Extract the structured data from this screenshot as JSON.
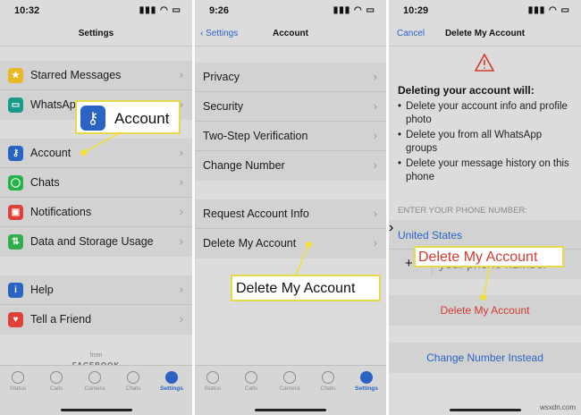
{
  "settings": {
    "time": "10:32",
    "title": "Settings",
    "rows": [
      {
        "label": "Starred Messages",
        "icon": "star-icon",
        "color": "#e8b923",
        "glyph": "★"
      },
      {
        "label": "WhatsApp",
        "icon": "laptop-icon",
        "color": "#1a9a8a",
        "glyph": "▭"
      },
      {
        "label": "Account",
        "icon": "key-icon",
        "color": "#2a63c4",
        "glyph": "⚷"
      },
      {
        "label": "Chats",
        "icon": "chat-bubble-icon",
        "color": "#25b34a",
        "glyph": "◯"
      },
      {
        "label": "Notifications",
        "icon": "notification-icon",
        "color": "#e0403a",
        "glyph": "▣"
      },
      {
        "label": "Data and Storage Usage",
        "icon": "data-arrows-icon",
        "color": "#2fae4e",
        "glyph": "⇅"
      },
      {
        "label": "Help",
        "icon": "info-icon",
        "color": "#2a63c4",
        "glyph": "i"
      },
      {
        "label": "Tell a Friend",
        "icon": "heart-icon",
        "color": "#e0403a",
        "glyph": "♥"
      }
    ],
    "footer_from": "from",
    "footer_brand": "FACEBOOK",
    "callout_label": "Account"
  },
  "account": {
    "time": "9:26",
    "back_label": "Settings",
    "title": "Account",
    "rows": [
      "Privacy",
      "Security",
      "Two-Step Verification",
      "Change Number"
    ],
    "rows2": [
      "Request Account Info",
      "Delete My Account"
    ],
    "callout_label": "Delete My Account"
  },
  "delete": {
    "time": "10:29",
    "cancel_label": "Cancel",
    "title": "Delete My Account",
    "warning_heading": "Deleting your account will:",
    "bullets": [
      "Delete your account info and profile photo",
      "Delete you from all WhatsApp groups",
      "Delete your message history on this phone"
    ],
    "phone_section_label": "ENTER YOUR PHONE NUMBER:",
    "country": "United States",
    "plus": "+",
    "phone_placeholder": "your phone number",
    "delete_button_label": "Delete My Account",
    "change_number_label": "Change Number Instead",
    "callout_label": "Delete My Account"
  },
  "tabs": [
    "Status",
    "Calls",
    "Camera",
    "Chats",
    "Settings"
  ],
  "watermark": "wsxdn.com",
  "colors": {
    "accent": "#2a63c4",
    "danger": "#d43a2f",
    "highlight": "#f2e033"
  }
}
